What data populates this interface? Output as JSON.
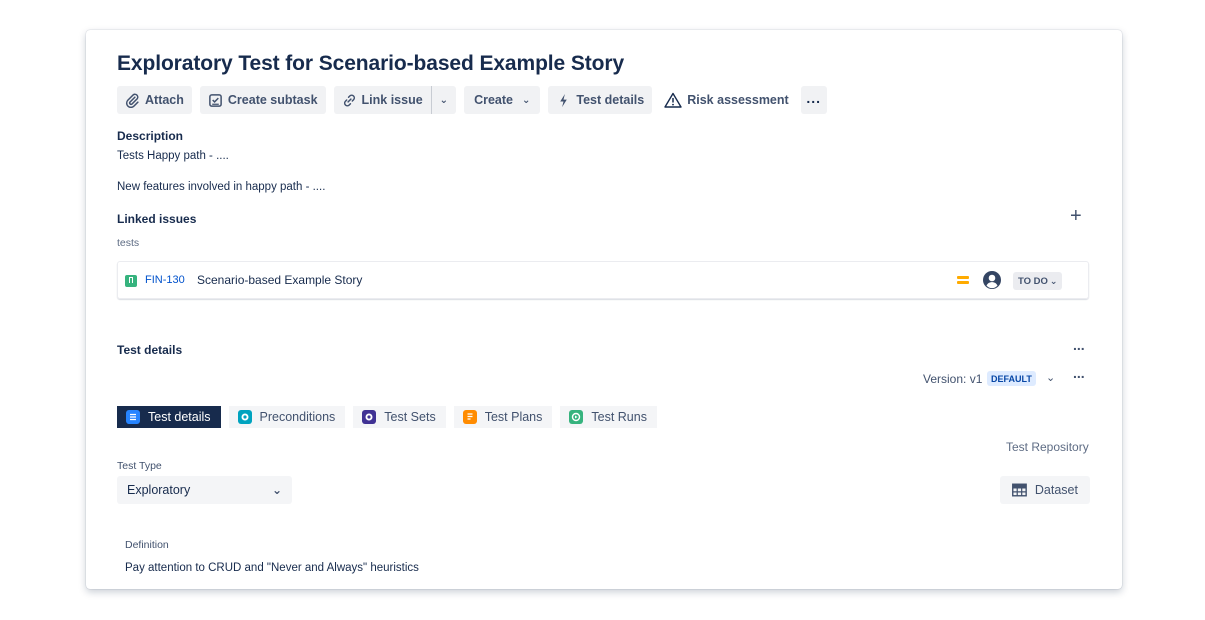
{
  "issue": {
    "title": "Exploratory Test for Scenario-based Example Story"
  },
  "toolbar": {
    "attach": "Attach",
    "create_subtask": "Create subtask",
    "link_issue": "Link issue",
    "create": "Create",
    "test_details": "Test details",
    "risk_assessment": "Risk assessment"
  },
  "description": {
    "label": "Description",
    "line1": "Tests Happy path - ....",
    "line2": "New features involved in happy path - ...."
  },
  "linked_issues": {
    "label": "Linked issues",
    "relation": "tests",
    "items": [
      {
        "key": "FIN-130",
        "summary": "Scenario-based Example Story",
        "status": "TO DO",
        "priority": "medium"
      }
    ]
  },
  "test_details": {
    "label": "Test details",
    "version_label": "Version: v1",
    "version_badge": "DEFAULT",
    "tabs": [
      {
        "label": "Test details",
        "active": true
      },
      {
        "label": "Preconditions",
        "active": false
      },
      {
        "label": "Test Sets",
        "active": false
      },
      {
        "label": "Test Plans",
        "active": false
      },
      {
        "label": "Test Runs",
        "active": false
      }
    ],
    "repository_link": "Test Repository",
    "test_type_label": "Test Type",
    "test_type_value": "Exploratory",
    "dataset_button": "Dataset",
    "definition_label": "Definition",
    "definition_value": "Pay attention to CRUD and \"Never and Always\" heuristics"
  },
  "colors": {
    "accent": "#0052cc",
    "active_tab": "#172b4d",
    "priority": "#ffab00",
    "story": "#36b37e"
  }
}
